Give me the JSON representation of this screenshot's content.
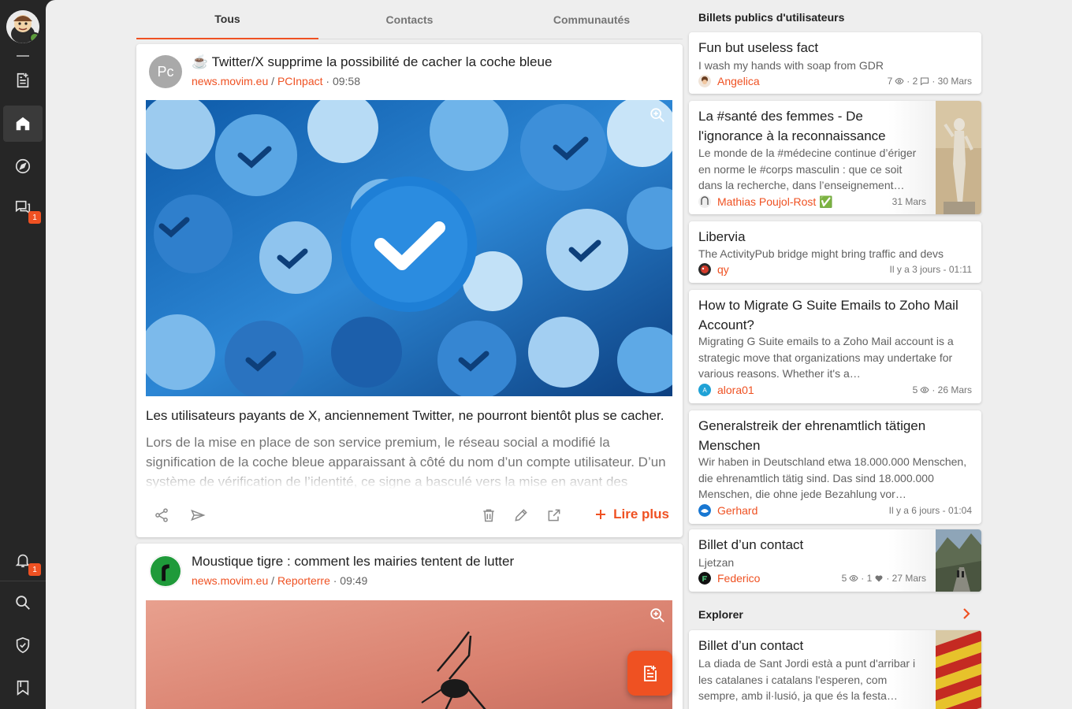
{
  "rail": {
    "notifications_badge": "1",
    "chats_badge": "1",
    "icons": [
      "user-avatar",
      "news-icon",
      "home-icon",
      "explore-icon",
      "chat-icon",
      "bell-icon",
      "search-icon",
      "verified-icon",
      "bookmark-icon"
    ]
  },
  "tabs": [
    {
      "label": "Tous",
      "active": true
    },
    {
      "label": "Contacts",
      "active": false
    },
    {
      "label": "Communautés",
      "active": false
    }
  ],
  "posts": [
    {
      "avatar_initials": "Pc",
      "emoji": "☕",
      "title": "Twitter/X supprime la possibilité de cacher la coche bleue",
      "server": "news.movim.eu",
      "separator": "/",
      "node": "PCInpact",
      "time": "· 09:58",
      "lead": "Les utilisateurs payants de X, anciennement Twitter, ne pourront bientôt plus se cacher.",
      "body": "Lors de la mise en place de son service premium, le réseau social a modifié la signification de la coche bleue apparaissant à côté du nom d’un compte utilisateur. D’un système de vérification de l’identité, ce signe a basculé vers la mise en avant des",
      "read_more": "Lire plus"
    },
    {
      "title": "Moustique tigre : comment les mairies tentent de lutter",
      "server": "news.movim.eu",
      "separator": "/",
      "node": "Reporterre",
      "time": "· 09:49"
    }
  ],
  "right": {
    "section_title": "Billets publics d'utilisateurs",
    "cards": [
      {
        "title": "Fun but useless fact",
        "summary": "I wash my hands with soap from GDR",
        "author": "Angelica",
        "views": "7",
        "comments": "· 2",
        "date": "· 30 Mars"
      },
      {
        "title": "La #santé des femmes - De l'ignorance à la reconnaissance",
        "summary": "Le monde de la #médecine continue d’ériger en norme le #corps masculin : que ce soit dans la recherche, dans l’enseignement…",
        "author": "Mathias Poujol-Rost ✅",
        "date": "31 Mars"
      },
      {
        "title": "Libervia",
        "summary": "The ActivityPub bridge might bring traffic and devs",
        "author": "qy",
        "date": "Il y a 3 jours - 01:11"
      },
      {
        "title": "How to Migrate G Suite Emails to Zoho Mail Account?",
        "summary": "Migrating G Suite emails to a Zoho Mail account is a strategic move that organizations may undertake for various reasons. Whether it's a…",
        "author": "alora01",
        "avatar_letter": "A",
        "views": "5",
        "date": "· 26 Mars"
      },
      {
        "title": "Generalstreik der ehrenamtlich tätigen Menschen",
        "summary": "Wir haben in Deutschland etwa 18.000.000 Menschen, die ehrenamtlich tätig sind. Das sind 18.000.000 Menschen, die ohne jede Bezahlung vor…",
        "author": "Gerhard",
        "date": "Il y a 6 jours - 01:04"
      },
      {
        "title": "Billet d’un contact",
        "summary": "Ljetzan",
        "author": "Federico",
        "views": "5",
        "likes": "· 1",
        "date": "· 27 Mars"
      }
    ],
    "explore_title": "Explorer",
    "explore_card": {
      "title": "Billet d’un contact",
      "summary": "La diada de Sant Jordi està a punt d'arribar i les catalanes i catalans l'esperen, com sempre, amb il·lusió, ja que és la festa…"
    }
  },
  "colors": {
    "accent": "#ef5122",
    "rail": "#262626",
    "page": "#eeeeee"
  }
}
